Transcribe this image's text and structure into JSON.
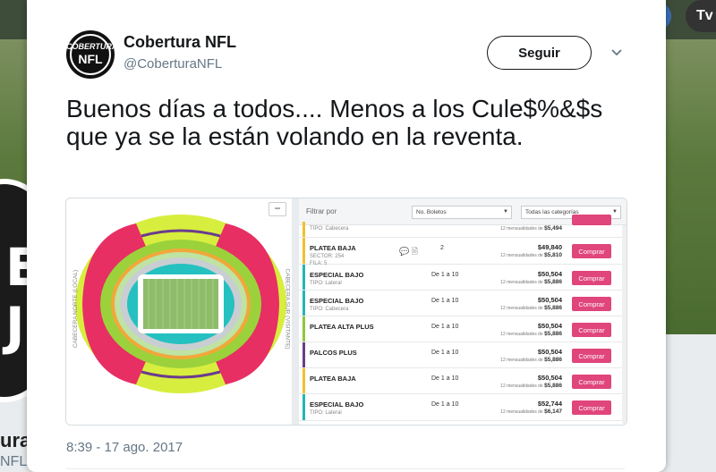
{
  "background": {
    "header_button_text": "Tv",
    "profile_name": "ura",
    "profile_handle": "NFL",
    "avatar_text": "ER\nJ"
  },
  "tweet": {
    "account_name": "Cobertura NFL",
    "handle": "@CoberturaNFL",
    "avatar_line1": "COBERTURA",
    "avatar_line2": "NFL",
    "follow_label": "Seguir",
    "text": "Buenos días a todos.... Menos a los Cule$%&$s que ya se la están volando en la reventa.",
    "timestamp": "8:39 - 17 ago. 2017"
  },
  "media": {
    "map": {
      "collapse_label": "−",
      "left_label": "CABECERA NORTE (LOCAL)",
      "right_label": "CABECERA SUR (VISITANTE)"
    },
    "filters": {
      "label": "Filtrar por",
      "tickets_select": "No. Boletos",
      "category_select": "Todas las categorías"
    },
    "rows": [
      {
        "title": "",
        "sub": "TIPO: Cabecera",
        "qty": "",
        "price": "",
        "installment_prefix": "12 mensualidades de",
        "installment_value": "$5,494",
        "buy": "",
        "color": "#f0c030"
      },
      {
        "title": "PLATEA BAJA",
        "sub": "SECTOR: 254\nFILA: 5",
        "qty": "2",
        "price": "$49,840",
        "installment_prefix": "12 mensualidades de",
        "installment_value": "$5,810",
        "buy": "Comprar",
        "color": "#f0c030",
        "icons": "💬 🗎"
      },
      {
        "title": "ESPECIAL BAJO",
        "sub": "TIPO: Lateral",
        "qty": "De 1 a 10",
        "price": "$50,504",
        "installment_prefix": "12 mensualidades de",
        "installment_value": "$5,886",
        "buy": "Comprar",
        "color": "#23b5b5"
      },
      {
        "title": "ESPECIAL BAJO",
        "sub": "TIPO: Cabecera",
        "qty": "De 1 a 10",
        "price": "$50,504",
        "installment_prefix": "12 mensualidades de",
        "installment_value": "$5,886",
        "buy": "Comprar",
        "color": "#23b5b5"
      },
      {
        "title": "PLATEA ALTA PLUS",
        "sub": "",
        "qty": "De 1 a 10",
        "price": "$50,504",
        "installment_prefix": "12 mensualidades de",
        "installment_value": "$5,886",
        "buy": "Comprar",
        "color": "#8ec63f"
      },
      {
        "title": "PALCOS PLUS",
        "sub": "",
        "qty": "De 1 a 10",
        "price": "$50,504",
        "installment_prefix": "12 mensualidades de",
        "installment_value": "$5,886",
        "buy": "Comprar",
        "color": "#6a3c8c"
      },
      {
        "title": "PLATEA BAJA",
        "sub": "",
        "qty": "De 1 a 10",
        "price": "$50,504",
        "installment_prefix": "12 mensualidades de",
        "installment_value": "$5,886",
        "buy": "Comprar",
        "color": "#f0c030"
      },
      {
        "title": "ESPECIAL BAJO",
        "sub": "TIPO: Lateral",
        "qty": "De 1 a 10",
        "price": "$52,744",
        "installment_prefix": "12 mensualidades de",
        "installment_value": "$6,147",
        "buy": "Comprar",
        "color": "#23b5b5"
      }
    ]
  },
  "colors": {
    "buy_button": "#e0457b",
    "text_primary": "#14171a",
    "text_secondary": "#657786"
  }
}
